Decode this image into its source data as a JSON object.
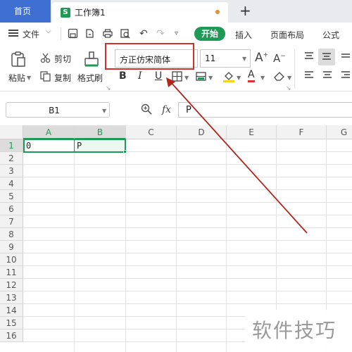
{
  "tabs": {
    "home": "首页",
    "document": "工作簿1",
    "doc_icon_letter": "S",
    "new_tab": "+"
  },
  "toolbar": {
    "file_menu": "文件",
    "ribbon_tabs": [
      "开始",
      "插入",
      "页面布局",
      "公式"
    ],
    "active_tab_color": "#1d9a55"
  },
  "ribbon": {
    "paste": "粘贴",
    "cut": "剪切",
    "copy": "复制",
    "format_painter": "格式刷",
    "font_name": "方正仿宋简体",
    "font_size": "11",
    "bold": "B",
    "italic": "I",
    "underline": "U",
    "font_color_letter": "A",
    "font_color_underline": "#e03030",
    "highlight_color": "#f7d21e"
  },
  "formula_bar": {
    "cell_ref": "B1",
    "fx_label": "fx",
    "value": "P"
  },
  "grid": {
    "columns": [
      "A",
      "B",
      "C",
      "D",
      "E",
      "F",
      "G"
    ],
    "rows": [
      "1",
      "2",
      "3",
      "4",
      "5",
      "6",
      "7",
      "8",
      "9",
      "10",
      "11",
      "12",
      "13",
      "14",
      "15",
      "16"
    ],
    "cells": {
      "A1": "0",
      "B1": "P"
    },
    "selection_color": "#1d9a55"
  },
  "annotation": {
    "highlight_color": "#d0312d",
    "arrow_color": "#b3261e"
  },
  "watermark": "软件技巧"
}
